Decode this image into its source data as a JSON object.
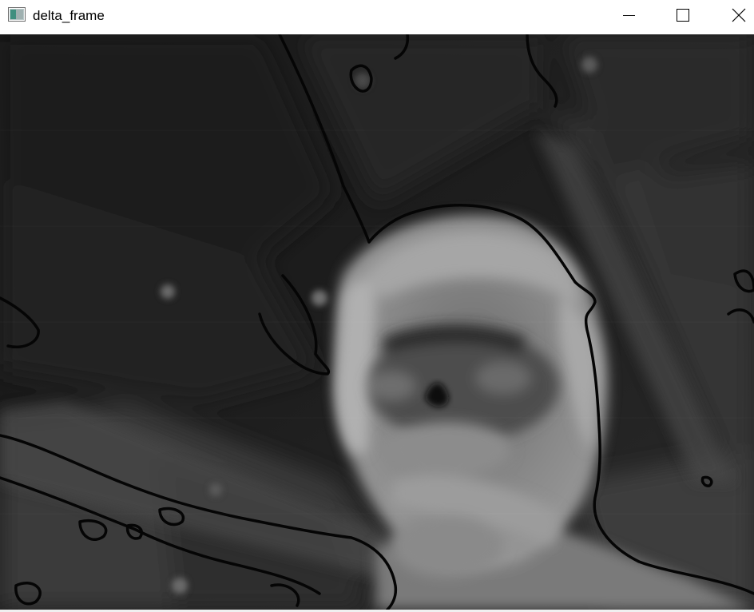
{
  "window": {
    "title": "delta_frame",
    "controls": {
      "minimize": "minimize-icon",
      "maximize": "maximize-icon",
      "close": "close-icon"
    }
  },
  "image": {
    "content": "grayscale-delta-frame-person",
    "background_color": "#1a1a1a"
  }
}
